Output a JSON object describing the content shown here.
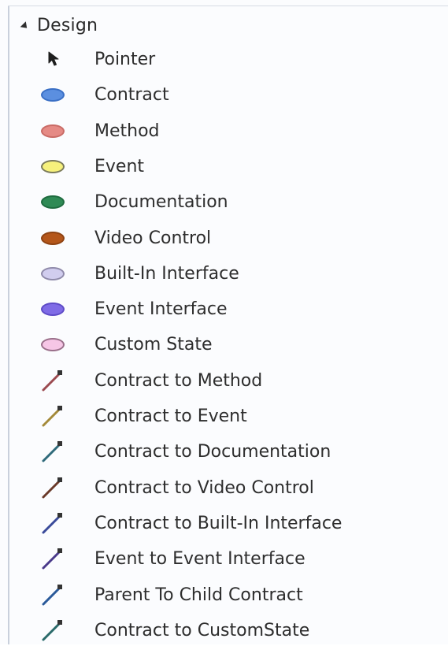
{
  "group": {
    "title": "Design"
  },
  "items": [
    {
      "label": "Pointer",
      "icon": "pointer-icon",
      "kind": "pointer"
    },
    {
      "label": "Contract",
      "icon": "oval-icon",
      "kind": "oval",
      "fill": "#5b8fe0",
      "stroke": "#3a6fc5"
    },
    {
      "label": "Method",
      "icon": "oval-icon",
      "kind": "oval",
      "fill": "#e58a85",
      "stroke": "#c96b66"
    },
    {
      "label": "Event",
      "icon": "oval-icon",
      "kind": "oval",
      "fill": "#f6f17c",
      "stroke": "#7a7a5a"
    },
    {
      "label": "Documentation",
      "icon": "oval-icon",
      "kind": "oval",
      "fill": "#2f8a55",
      "stroke": "#1e6b3f"
    },
    {
      "label": "Video Control",
      "icon": "oval-icon",
      "kind": "oval",
      "fill": "#b4561a",
      "stroke": "#8e4212"
    },
    {
      "label": "Built-In Interface",
      "icon": "oval-icon",
      "kind": "oval",
      "fill": "#d1cdef",
      "stroke": "#8f8aaa"
    },
    {
      "label": "Event Interface",
      "icon": "oval-icon",
      "kind": "oval",
      "fill": "#7f6be6",
      "stroke": "#5e4bc7"
    },
    {
      "label": "Custom State",
      "icon": "oval-icon",
      "kind": "oval",
      "fill": "#f6c6e6",
      "stroke": "#9a6f8a"
    },
    {
      "label": "Contract to Method",
      "icon": "connector-icon",
      "kind": "connector",
      "color": "#9b4a50"
    },
    {
      "label": "Contract to Event",
      "icon": "connector-icon",
      "kind": "connector",
      "color": "#a48a3a"
    },
    {
      "label": "Contract to Documentation",
      "icon": "connector-icon",
      "kind": "connector",
      "color": "#2f6a7a"
    },
    {
      "label": "Contract to Video Control",
      "icon": "connector-icon",
      "kind": "connector",
      "color": "#6a3a2a"
    },
    {
      "label": "Contract to Built-In Interface",
      "icon": "connector-icon",
      "kind": "connector",
      "color": "#3a4a9a"
    },
    {
      "label": "Event to Event Interface",
      "icon": "connector-icon",
      "kind": "connector",
      "color": "#4a3a8a"
    },
    {
      "label": "Parent To Child Contract",
      "icon": "connector-icon",
      "kind": "connector",
      "color": "#2a5a9a"
    },
    {
      "label": "Contract to CustomState",
      "icon": "connector-icon",
      "kind": "connector",
      "color": "#2a6a6a"
    }
  ]
}
